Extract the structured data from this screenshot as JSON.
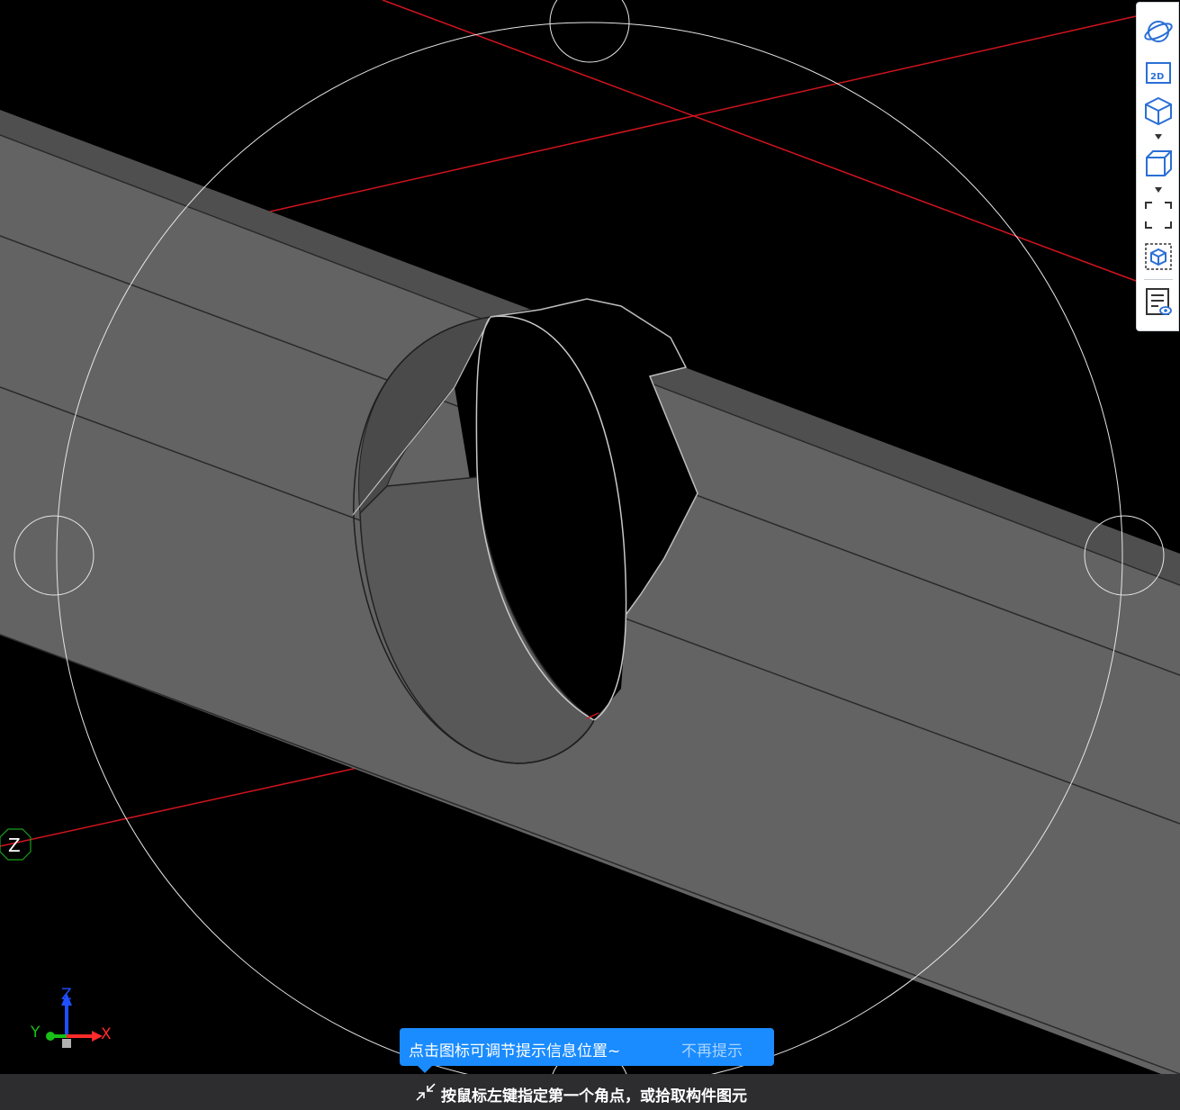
{
  "viewport": {
    "background": "#000000",
    "member_face_color": "#636363",
    "member_top_color": "#4f4f4f",
    "reference_line_color": "#d0141e",
    "rotate_guide_color": "#e6e6e6",
    "z_marker_label": "Z"
  },
  "toolbar": {
    "items": [
      {
        "name": "orbit-icon"
      },
      {
        "name": "2d-view-icon",
        "label": "2D"
      },
      {
        "name": "3d-view-icon"
      },
      {
        "name": "box-display-icon"
      },
      {
        "name": "fit-window-icon"
      },
      {
        "name": "selection-box-icon"
      },
      {
        "name": "property-view-icon"
      }
    ]
  },
  "axis_triad": {
    "x_label": "X",
    "y_label": "Y",
    "z_label": "Z",
    "x_color": "#ff2a2a",
    "y_color": "#18c018",
    "z_color": "#1f4fff"
  },
  "hint": {
    "text": "点击图标可调节提示信息位置~",
    "dismiss": "不再提示",
    "color": "#1a8cff"
  },
  "status_bar": {
    "text": "按鼠标左键指定第一个角点，或拾取构件图元"
  }
}
